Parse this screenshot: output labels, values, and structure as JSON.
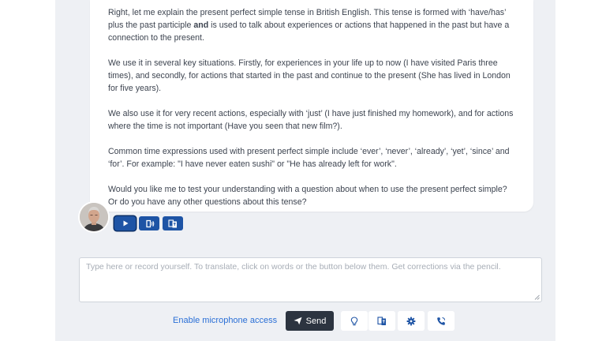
{
  "message": {
    "paragraphs": [
      {
        "before": "Right, let me explain the present perfect simple tense in British English. This tense is formed with ‘have/has’ plus the past participle ",
        "bold": "and",
        "after": " is used to talk about experiences or actions that happened in the past but have a connection to the present."
      },
      {
        "text": "We use it in several key situations. Firstly, for experiences in your life up to now (I have visited Paris three times), and secondly, for actions that started in the past and continue to the present (She has lived in London for five years)."
      },
      {
        "text": "We also use it for very recent actions, especially with ‘just’ (I have just finished my homework), and for actions where the time is not important (Have you seen that new film?)."
      },
      {
        "text": "Common time expressions used with present perfect simple include ‘ever’, ‘never’, ‘already’, ‘yet’, ‘since’ and ‘for’. For example: \"I have never eaten sushi\" or \"He has already left for work\"."
      },
      {
        "text": "Would you like me to test your understanding with a question about when to use the present perfect simple? Or do you have any other questions about this tense?"
      }
    ]
  },
  "message_tools": [
    {
      "name": "play-button",
      "icon": "play-icon"
    },
    {
      "name": "speaker-button",
      "icon": "speaker-icon"
    },
    {
      "name": "translate-button",
      "icon": "translate-icon"
    }
  ],
  "composer": {
    "placeholder": "Type here or record yourself. To translate, click on words or the button below them. Get corrections via the pencil."
  },
  "footer": {
    "mic_link": "Enable microphone access",
    "send_label": "Send",
    "icons": [
      "lightbulb-icon",
      "translate-icon",
      "gear-icon",
      "phone-icon"
    ]
  },
  "colors": {
    "accent_blue": "#1e54a5",
    "send_bg": "#2c3440",
    "link": "#2a6fd6",
    "frame_bg": "#eef0f4"
  }
}
